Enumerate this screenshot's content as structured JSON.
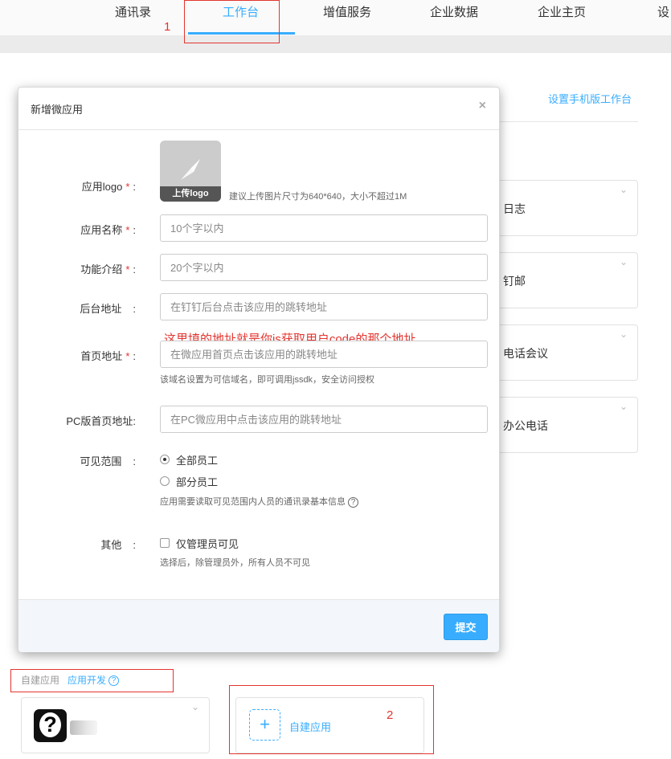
{
  "nav": {
    "items": [
      {
        "label": "通讯录"
      },
      {
        "label": "工作台"
      },
      {
        "label": "增值服务"
      },
      {
        "label": "企业数据"
      },
      {
        "label": "企业主页"
      },
      {
        "label": "设"
      }
    ],
    "active_index": 1
  },
  "annotations": {
    "num1": "1",
    "num2": "2",
    "color": "#e3342f",
    "note": "这里填的地址就是你js获取用户code的那个地址"
  },
  "background": {
    "mobile_link": "设置手机版工作台",
    "cards": [
      {
        "label": "日志",
        "icon": "chevron-down-icon"
      },
      {
        "label": "钉邮",
        "icon": "chevron-down-icon"
      },
      {
        "label": "电话会议",
        "icon": "chevron-down-icon"
      },
      {
        "label": "办公电话",
        "icon": "chevron-down-icon"
      }
    ]
  },
  "modal": {
    "title": "新增微应用",
    "close": "×",
    "logo": {
      "label": "应用logo",
      "upload_label": "上传logo",
      "hint": "建议上传图片尺寸为640*640，大小不超过1M"
    },
    "fields": {
      "name": {
        "label": "应用名称",
        "placeholder": "10个字以内"
      },
      "intro": {
        "label": "功能介绍",
        "placeholder": "20个字以内"
      },
      "backend": {
        "label": "后台地址",
        "placeholder": "在钉钉后台点击该应用的跳转地址"
      },
      "homepage": {
        "label": "首页地址",
        "placeholder": "在微应用首页点击该应用的跳转地址",
        "help": "该域名设置为可信域名，即可调用jssdk，安全访问授权"
      },
      "pc_homepage": {
        "label": "PC版首页地址",
        "placeholder": "在PC微应用中点击该应用的跳转地址"
      }
    },
    "required_mark": "*",
    "colon": ":",
    "visibility": {
      "label": "可见范围",
      "options": [
        "全部员工",
        "部分员工"
      ],
      "selected": "全部员工",
      "help": "应用需要读取可见范围内人员的通讯录基本信息"
    },
    "other": {
      "label": "其他",
      "checkbox_label": "仅管理员可见",
      "checked": false,
      "help": "选择后，除管理员外，所有人员不可见"
    },
    "submit": "提交",
    "help_icon": "?"
  },
  "bottom": {
    "section_title": "自建应用",
    "dev_link": "应用开发",
    "app_icon_glyph": "?",
    "add_icon": "+",
    "add_label": "自建应用"
  },
  "colors": {
    "accent": "#38adff",
    "required": "#e3342f"
  }
}
